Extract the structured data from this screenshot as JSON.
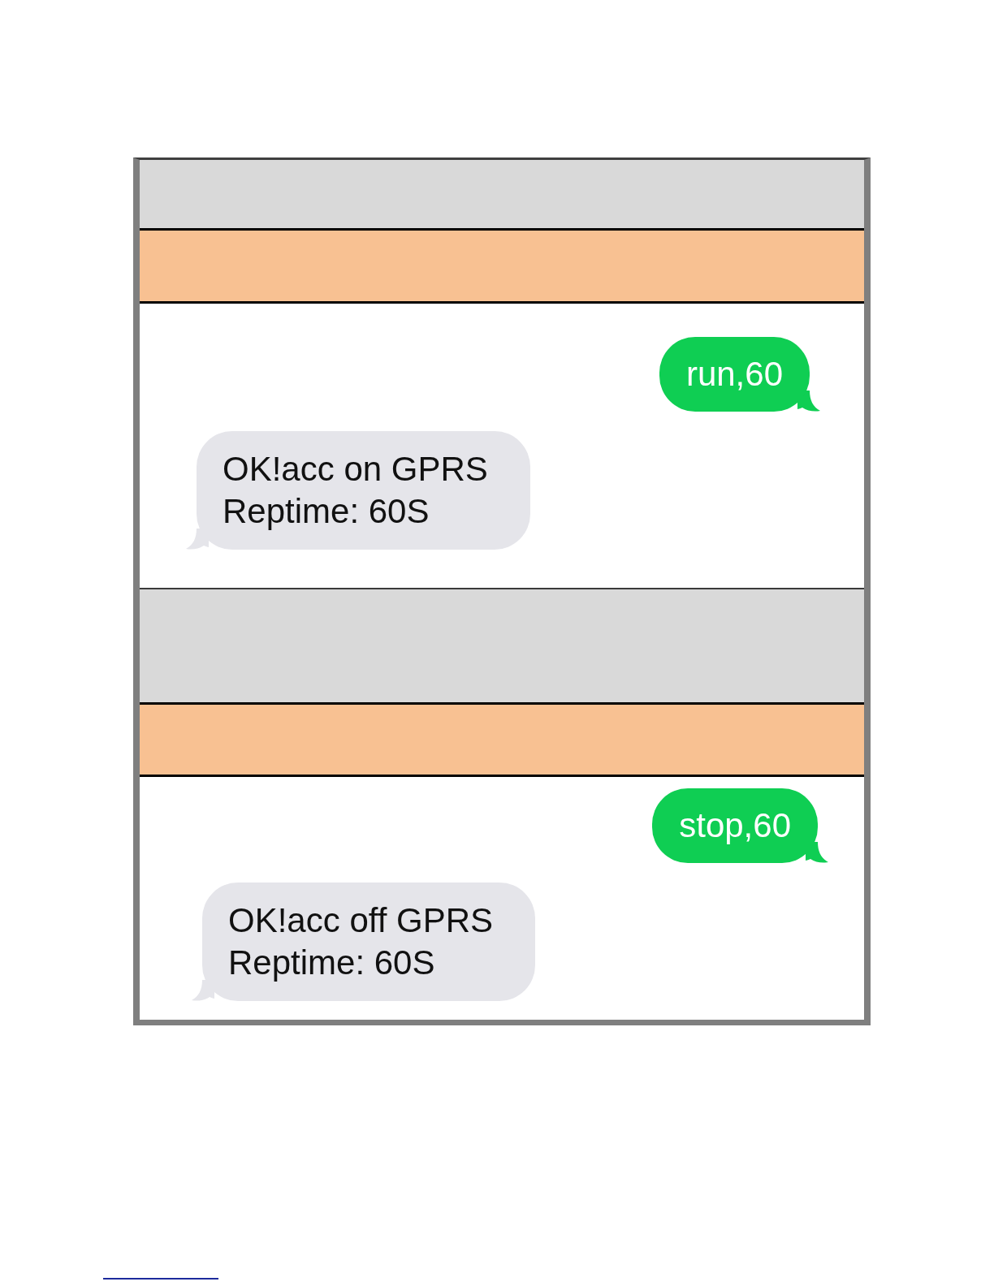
{
  "conversations": [
    {
      "messages": [
        {
          "kind": "sent",
          "text": "run,60"
        },
        {
          "kind": "received",
          "text": "OK!acc on GPRS\nReptime: 60S"
        }
      ]
    },
    {
      "messages": [
        {
          "kind": "sent",
          "text": "stop,60"
        },
        {
          "kind": "received",
          "text": "OK!acc off GPRS\nReptime: 60S"
        }
      ]
    }
  ]
}
